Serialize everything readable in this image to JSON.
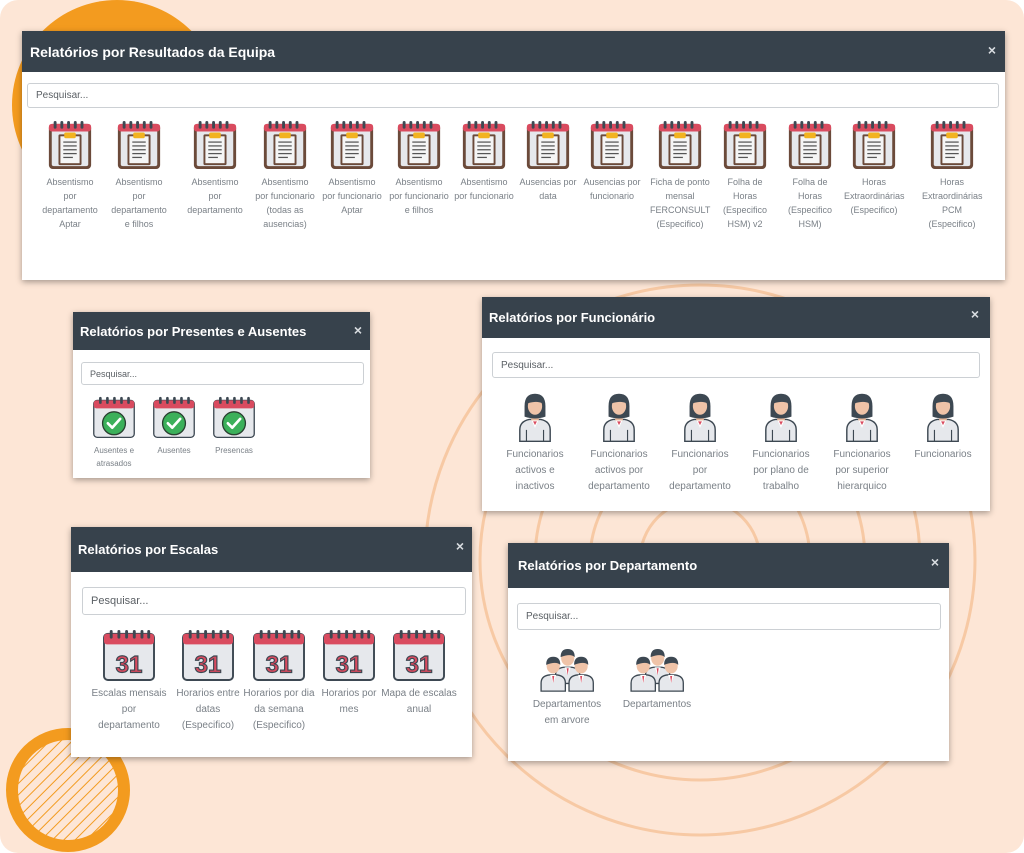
{
  "colors": {
    "header_bg": "#37424c",
    "page_bg": "#fde6d6",
    "accent_orange": "#f39b1f",
    "label_gray": "#7a8087",
    "calendar_red": "#d94b5f"
  },
  "panels": {
    "equipa": {
      "title": "Relatórios por Resultados da Equipa",
      "close": "×",
      "search_placeholder": "Pesquisar...",
      "items": [
        {
          "label": "Absentismo por departamento Aptar",
          "icon": "clipboard-icon"
        },
        {
          "label": "Absentismo por departamento e filhos",
          "icon": "clipboard-icon"
        },
        {
          "label": "Absentismo por departamento",
          "icon": "clipboard-icon"
        },
        {
          "label": "Absentismo por funcionario (todas as ausencias)",
          "icon": "clipboard-icon"
        },
        {
          "label": "Absentismo por funcionario Aptar",
          "icon": "clipboard-icon"
        },
        {
          "label": "Absentismo por funcionario e filhos",
          "icon": "clipboard-icon"
        },
        {
          "label": "Absentismo por funcionario",
          "icon": "clipboard-icon"
        },
        {
          "label": "Ausencias por data",
          "icon": "clipboard-icon"
        },
        {
          "label": "Ausencias por funcionario",
          "icon": "clipboard-icon"
        },
        {
          "label": "Ficha de ponto mensal FERCONSULT (Especifico)",
          "icon": "clipboard-icon"
        },
        {
          "label": "Folha de Horas (Especifico HSM) v2",
          "icon": "clipboard-icon"
        },
        {
          "label": "Folha de Horas (Especifico HSM)",
          "icon": "clipboard-icon"
        },
        {
          "label": "Horas Extraordinárias (Especifico)",
          "icon": "clipboard-icon"
        },
        {
          "label": "Horas Extraordinárias PCM (Especifico)",
          "icon": "clipboard-icon"
        }
      ]
    },
    "presentes": {
      "title": "Relatórios por Presentes e Ausentes",
      "close": "×",
      "search_placeholder": "Pesquisar...",
      "items": [
        {
          "label": "Ausentes e atrasados",
          "icon": "calendar-check-icon"
        },
        {
          "label": "Ausentes",
          "icon": "calendar-check-icon"
        },
        {
          "label": "Presencas",
          "icon": "calendar-check-icon"
        }
      ]
    },
    "funcionario": {
      "title": "Relatórios por Funcionário",
      "close": "×",
      "search_placeholder": "Pesquisar...",
      "items": [
        {
          "label": "Funcionarios activos e inactivos",
          "icon": "employee-icon"
        },
        {
          "label": "Funcionarios activos por departamento",
          "icon": "employee-icon"
        },
        {
          "label": "Funcionarios por departamento",
          "icon": "employee-icon"
        },
        {
          "label": "Funcionarios por plano de trabalho",
          "icon": "employee-icon"
        },
        {
          "label": "Funcionarios por superior hierarquico",
          "icon": "employee-icon"
        },
        {
          "label": "Funcionarios",
          "icon": "employee-icon"
        }
      ]
    },
    "escalas": {
      "title": "Relatórios por Escalas",
      "close": "×",
      "search_placeholder": "Pesquisar...",
      "calendar_day": "31",
      "items": [
        {
          "label": "Escalas mensais por departamento",
          "icon": "calendar-31-icon"
        },
        {
          "label": "Horarios entre datas (Especifico)",
          "icon": "calendar-31-icon"
        },
        {
          "label": "Horarios por dia da semana (Especifico)",
          "icon": "calendar-31-icon"
        },
        {
          "label": "Horarios por mes",
          "icon": "calendar-31-icon"
        },
        {
          "label": "Mapa de escalas anual",
          "icon": "calendar-31-icon"
        }
      ]
    },
    "departamento": {
      "title": "Relatórios por Departamento",
      "close": "×",
      "search_placeholder": "Pesquisar...",
      "items": [
        {
          "label": "Departamentos em arvore",
          "icon": "team-icon"
        },
        {
          "label": "Departamentos",
          "icon": "team-icon"
        }
      ]
    }
  }
}
